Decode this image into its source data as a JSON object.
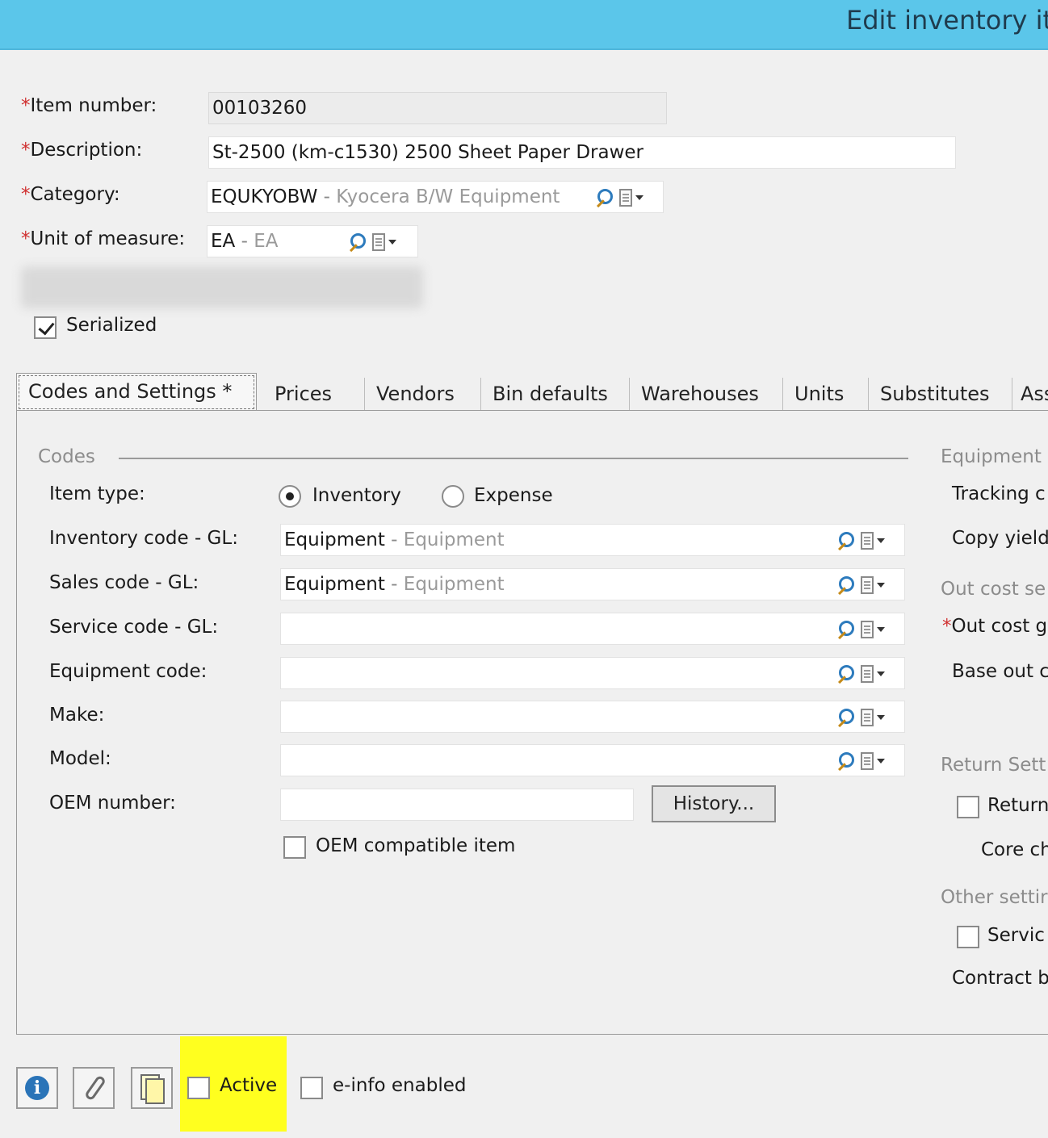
{
  "window": {
    "title": "Edit inventory it"
  },
  "header_fields": {
    "item_number": {
      "label": "Item number:",
      "value": "00103260"
    },
    "description": {
      "label": "Description:",
      "value": "St-2500 (km-c1530) 2500 Sheet Paper Drawer"
    },
    "category": {
      "label": "Category:",
      "code": "EQUKYOBW",
      "separator": " - ",
      "name": "Kyocera B/W Equipment"
    },
    "unit_of_measure": {
      "label": "Unit of measure:",
      "code": "EA",
      "separator": " - ",
      "name": "EA"
    },
    "required_marker": "*",
    "serialized": {
      "label": "Serialized",
      "checked": true
    }
  },
  "tabs": [
    {
      "label": "Codes and Settings *",
      "active": true
    },
    {
      "label": "Prices"
    },
    {
      "label": "Vendors"
    },
    {
      "label": "Bin defaults"
    },
    {
      "label": "Warehouses"
    },
    {
      "label": "Units"
    },
    {
      "label": "Substitutes"
    },
    {
      "label": "Ass"
    }
  ],
  "codes": {
    "section_title": "Codes",
    "item_type": {
      "label": "Item type:",
      "options": [
        "Inventory",
        "Expense"
      ],
      "selected": "Inventory"
    },
    "inventory_code": {
      "label": "Inventory code - GL:",
      "code": "Equipment",
      "separator": " - ",
      "name": "Equipment"
    },
    "sales_code": {
      "label": "Sales code - GL:",
      "code": "Equipment",
      "separator": " - ",
      "name": "Equipment"
    },
    "service_code": {
      "label": "Service code - GL:",
      "value": ""
    },
    "equipment_code": {
      "label": "Equipment code:",
      "value": ""
    },
    "make": {
      "label": "Make:",
      "value": ""
    },
    "model": {
      "label": "Model:",
      "value": ""
    },
    "oem_number": {
      "label": "OEM number:",
      "value": ""
    },
    "history_button": "History...",
    "oem_compatible": {
      "label": "OEM compatible item",
      "checked": false
    }
  },
  "right_column": {
    "equipment_section": "Equipment s",
    "tracking": "Tracking c",
    "copy_yield": "Copy yield",
    "out_cost_section": "Out cost se",
    "out_cost_group": "Out cost g",
    "base_out": "Base out c",
    "return_section": "Return Sett",
    "return_checkbox": "Return",
    "core_charge": "Core ch",
    "other_section": "Other settir",
    "service_checkbox": "Servic",
    "contract": "Contract b"
  },
  "footer": {
    "icons": [
      "info-icon",
      "paperclip-icon",
      "notes-icon"
    ],
    "active": {
      "label": "Active",
      "checked": false
    },
    "einfo": {
      "label": "e-info enabled",
      "checked": false
    }
  },
  "colors": {
    "titlebar": "#5bc6ea",
    "highlight": "#ffff1f",
    "required": "#d03030"
  }
}
